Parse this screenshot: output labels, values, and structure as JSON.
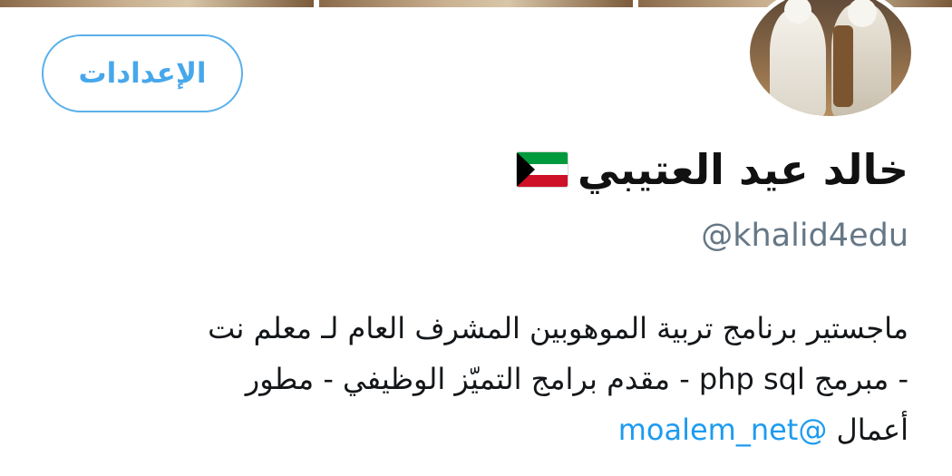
{
  "header": {
    "settings_label": "الإعدادات"
  },
  "profile": {
    "display_name": "خالد عيد العتيبي",
    "flag_icon": "kuwait-flag-icon",
    "handle": "@khalid4edu",
    "bio_lines": [
      "ماجستير برنامج تربية الموهوبين المشرف العام لـ معلم نت",
      "- مبرمج php sql - مقدم برامج التميّز الوظيفي - مطور",
      "أعمال"
    ],
    "bio_mention": "@moalem_net"
  },
  "colors": {
    "accent": "#1d9bf0",
    "muted_text": "#657786",
    "button_border": "#5ab0eb"
  }
}
